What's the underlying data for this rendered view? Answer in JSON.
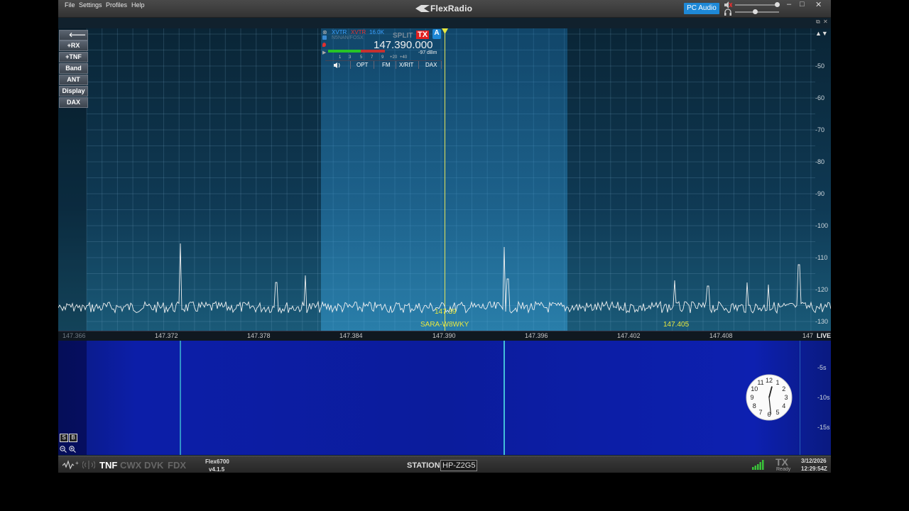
{
  "menu": [
    "File",
    "Settings",
    "Profiles",
    "Help"
  ],
  "brand": "FlexRadio",
  "pc_audio_label": "PC Audio",
  "window_controls": {
    "minimize": "–",
    "maximize": "□",
    "close": "✕"
  },
  "subbar_controls": {
    "restore": "⧉",
    "close": "✕"
  },
  "side_buttons": [
    "+RX",
    "+TNF",
    "Band",
    "ANT",
    "Display",
    "DAX"
  ],
  "back_arrow": "🡐",
  "pan_arrows": "▲▼",
  "dbm_scale": [
    "-50",
    "-60",
    "-70",
    "-80",
    "-90",
    "-100",
    "-110",
    "-120",
    "-130"
  ],
  "slice": {
    "xvtr1": "XVTR",
    "xvtr2": "XVTR",
    "bandwidth": "16.0K",
    "ant": "N5NAN/FOSX",
    "split": "SPLIT",
    "tx": "TX",
    "letter": "A",
    "frequency": "147.390.000",
    "level": "-97 dBm",
    "smeter_ticks": [
      "1",
      "3",
      "5",
      "7",
      "9",
      "+20",
      "+40"
    ],
    "tabs": [
      "OPT",
      "FM",
      "X/RIT",
      "DAX"
    ],
    "speaker_icon": "speaker-icon"
  },
  "spots": [
    {
      "freq": "147.39",
      "call": "SARA-W8WKY"
    },
    {
      "freq": "147.405",
      "call": ""
    }
  ],
  "ruler_ticks": [
    "147.366",
    "147.372",
    "147.378",
    "147.384",
    "147.390",
    "147.396",
    "147.402",
    "147.408",
    "147"
  ],
  "ruler_live": "LIVE",
  "waterfall_times": [
    "-5s",
    "-10s",
    "-15s"
  ],
  "clock": {
    "numbers": [
      "12",
      "1",
      "2",
      "3",
      "4",
      "5",
      "6",
      "7",
      "8",
      "9",
      "10",
      "11"
    ],
    "hour": 12,
    "minute": 29
  },
  "status": {
    "tnf": "TNF",
    "cwx": "CWX",
    "dvk": "DVK",
    "fdx": "FDX",
    "model": "Flex6700",
    "version": "v4.1.5",
    "station_label": "STATION:",
    "station_name": "HP-Z2G5",
    "tx": "TX",
    "tx_state": "Ready",
    "date": "3/12/2026",
    "time": "12:29:54Z"
  },
  "colors": {
    "accent": "#1e88d6",
    "tx_red": "#e02020",
    "spot_yellow": "#e8e840"
  }
}
